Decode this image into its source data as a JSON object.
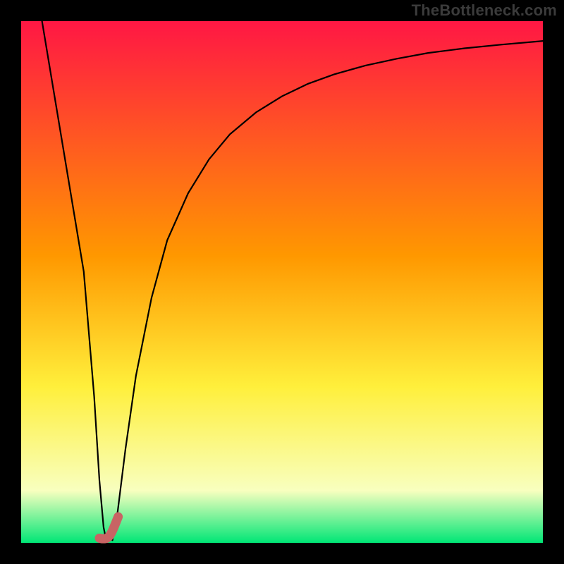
{
  "watermark": "TheBottleneck.com",
  "frame": {
    "outer_w": 800,
    "outer_h": 800,
    "inner_x": 30,
    "inner_y": 30,
    "inner_w": 740,
    "inner_h": 740
  },
  "colors": {
    "frame": "#000000",
    "curve": "#000000",
    "marker_fill": "#c86464",
    "marker_stroke": "#c86464",
    "grad_top": "#ff1744",
    "grad_orange": "#ff9800",
    "grad_yellow": "#ffef3b",
    "grad_pale": "#f8ffbf",
    "grad_green": "#00e676"
  },
  "chart_data": {
    "type": "line",
    "title": "",
    "xlabel": "",
    "ylabel": "",
    "xlim": [
      0,
      100
    ],
    "ylim": [
      0,
      100
    ],
    "series": [
      {
        "name": "left-leg",
        "x": [
          4.0,
          6.0,
          8.0,
          10.0,
          12.0,
          14.0,
          15.0,
          15.8,
          16.3
        ],
        "values": [
          100,
          88,
          76,
          64,
          52,
          28,
          12,
          3,
          0.5
        ]
      },
      {
        "name": "right-curve",
        "x": [
          17.5,
          18.5,
          20,
          22,
          25,
          28,
          32,
          36,
          40,
          45,
          50,
          55,
          60,
          66,
          72,
          78,
          85,
          92,
          100
        ],
        "values": [
          0.5,
          6,
          18,
          32,
          47,
          58,
          67,
          73.5,
          78.3,
          82.5,
          85.6,
          88,
          89.8,
          91.5,
          92.8,
          93.9,
          94.8,
          95.5,
          96.2
        ]
      }
    ],
    "marker": {
      "name": "selected-point",
      "points_pct": [
        [
          18.6,
          5.0
        ],
        [
          18.2,
          4.0
        ],
        [
          17.8,
          3.0
        ],
        [
          17.4,
          2.1
        ],
        [
          17.0,
          1.4
        ],
        [
          16.5,
          0.9
        ],
        [
          16.0,
          0.8
        ],
        [
          15.5,
          0.8
        ],
        [
          15.0,
          0.9
        ]
      ],
      "stroke_w": 13
    }
  }
}
